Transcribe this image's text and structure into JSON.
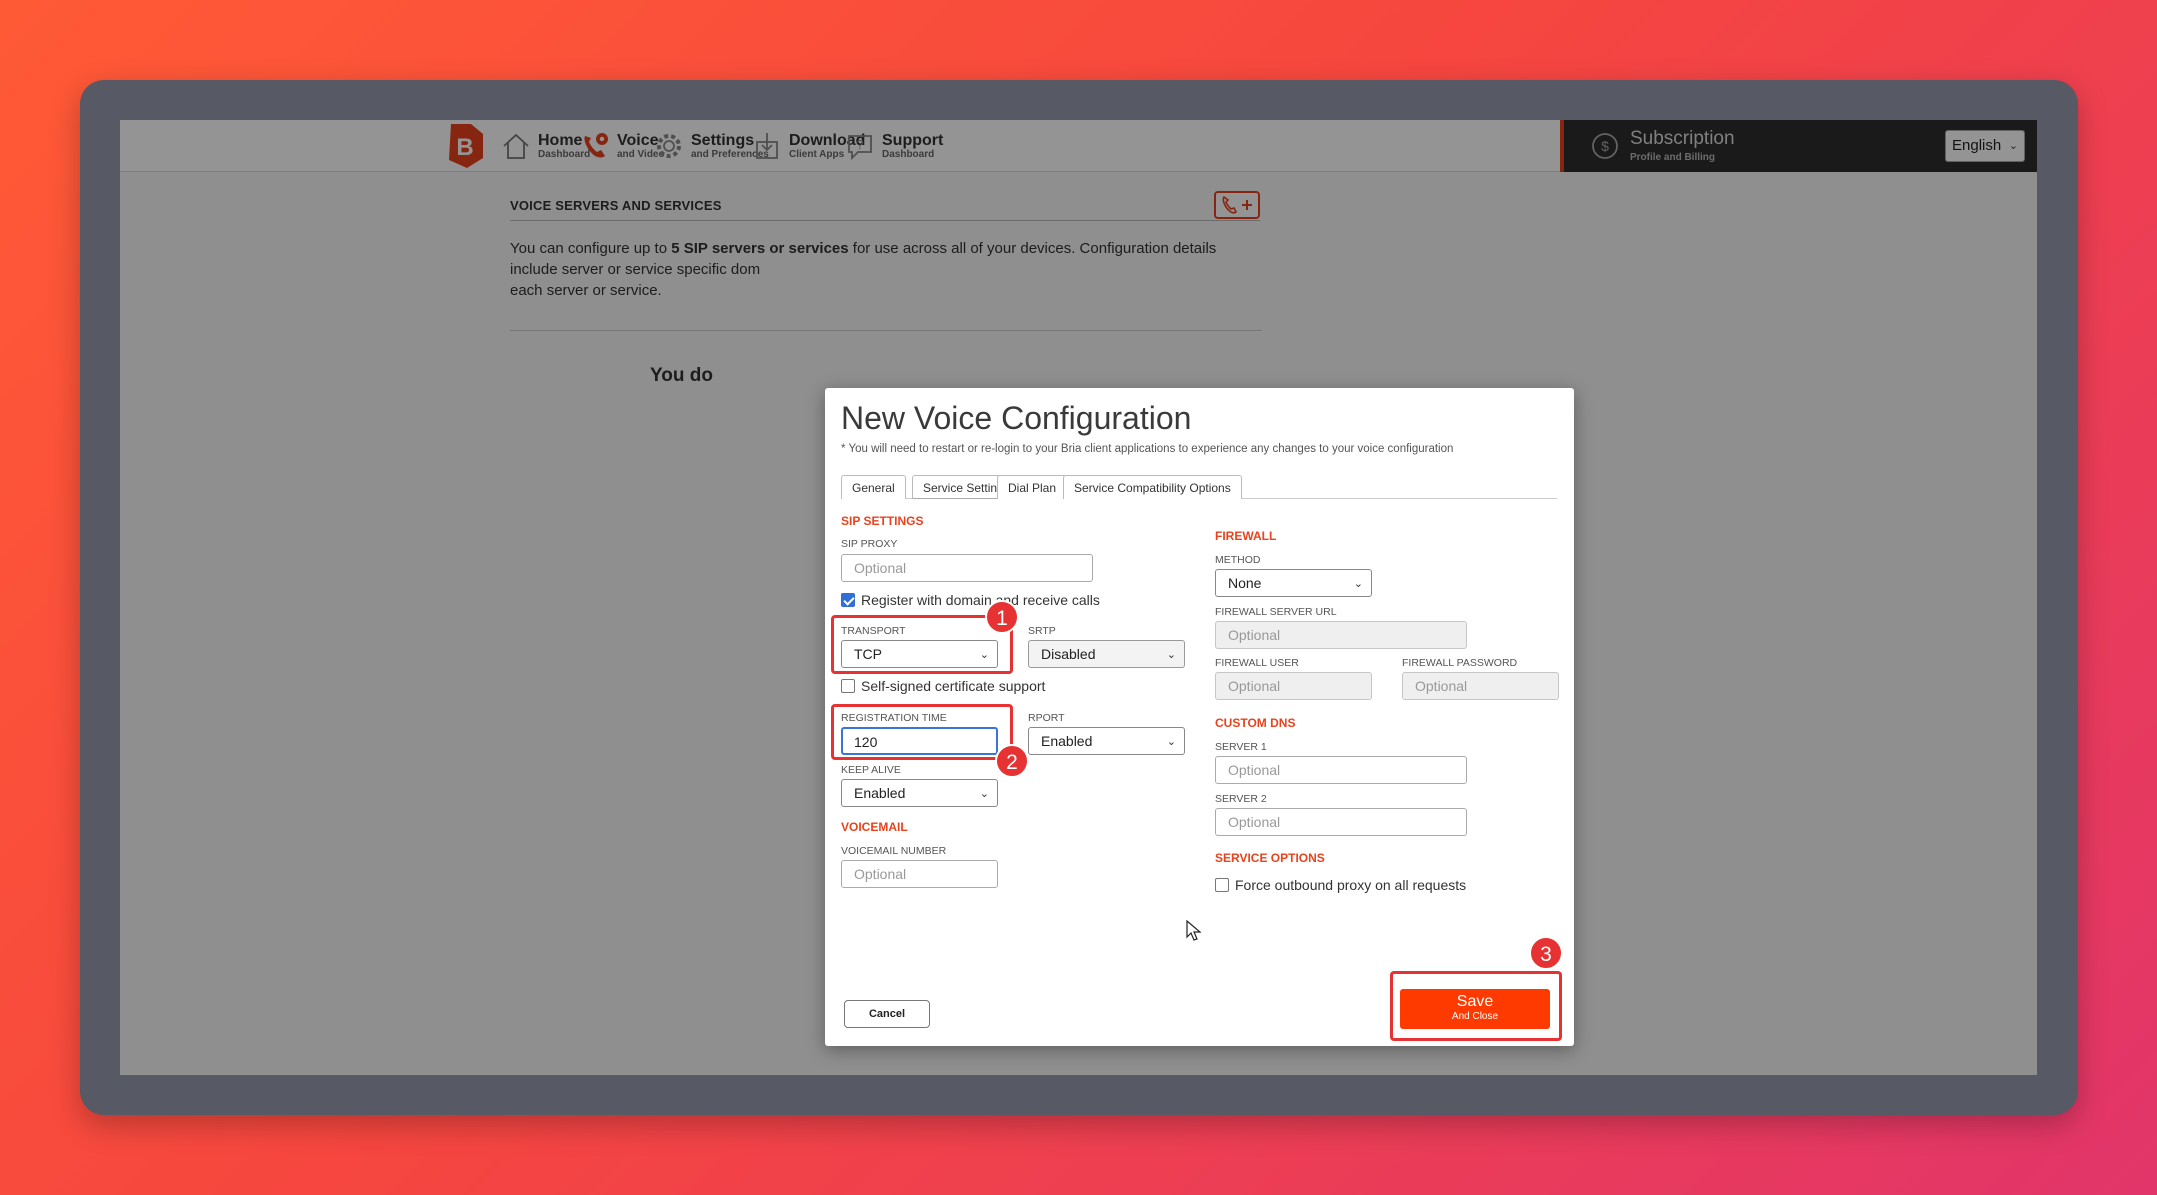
{
  "nav": {
    "items": [
      {
        "title": "Home",
        "subtitle": "Dashboard",
        "icon": "home-icon"
      },
      {
        "title": "Voice",
        "subtitle": "and Video",
        "icon": "phone-gear-icon"
      },
      {
        "title": "Settings",
        "subtitle": "and Preferences",
        "icon": "gear-icon"
      },
      {
        "title": "Download",
        "subtitle": "Client Apps",
        "icon": "download-icon"
      },
      {
        "title": "Support",
        "subtitle": "Dashboard",
        "icon": "support-chat-icon"
      }
    ],
    "subscription": {
      "title": "Subscription",
      "subtitle": "Profile and Billing",
      "icon": "dollar-refresh-icon"
    },
    "language": "English"
  },
  "page": {
    "heading": "VOICE SERVERS AND SERVICES",
    "paragraph_pre": "You can configure up to ",
    "paragraph_bold": "5 SIP servers or services",
    "paragraph_post": " for use across all of your devices. Configuration details include server or service specific dom",
    "paragraph_line3": "each server or service.",
    "partial_text": "You do"
  },
  "modal": {
    "title": "New Voice Configuration",
    "note": "* You will need to restart or re-login to your Bria client applications to experience any changes to your voice configuration",
    "tabs": [
      "General",
      "Service Settings",
      "Dial Plan",
      "Service Compatibility Options"
    ],
    "active_tab": "Service Settings",
    "sip": {
      "section": "SIP SETTINGS",
      "proxy_label": "SIP PROXY",
      "proxy_placeholder": "Optional",
      "register_label": "Register with domain and receive calls",
      "register_checked": true,
      "transport_label": "TRANSPORT",
      "transport_value": "TCP",
      "srtp_label": "SRTP",
      "srtp_value": "Disabled",
      "selfsigned_label": "Self-signed certificate support",
      "selfsigned_checked": false,
      "regtime_label": "REGISTRATION TIME",
      "regtime_value": "120",
      "rport_label": "RPORT",
      "rport_value": "Enabled",
      "keepalive_label": "KEEP ALIVE",
      "keepalive_value": "Enabled"
    },
    "voicemail": {
      "section": "VOICEMAIL",
      "number_label": "VOICEMAIL NUMBER",
      "number_placeholder": "Optional"
    },
    "firewall": {
      "section": "FIREWALL",
      "method_label": "METHOD",
      "method_value": "None",
      "server_url_label": "FIREWALL SERVER URL",
      "server_url_placeholder": "Optional",
      "user_label": "FIREWALL USER",
      "user_placeholder": "Optional",
      "password_label": "FIREWALL PASSWORD",
      "password_placeholder": "Optional"
    },
    "dns": {
      "section": "CUSTOM DNS",
      "server1_label": "SERVER 1",
      "server1_placeholder": "Optional",
      "server2_label": "SERVER 2",
      "server2_placeholder": "Optional"
    },
    "service_options": {
      "section": "SERVICE OPTIONS",
      "force_proxy_label": "Force outbound proxy on all requests",
      "force_proxy_checked": false
    },
    "cancel_label": "Cancel",
    "save_label": "Save",
    "save_sublabel": "And Close"
  },
  "annotations": [
    "1",
    "2",
    "3"
  ],
  "colors": {
    "accent": "#e8431d",
    "highlight": "#e63232",
    "save": "#ff3a00"
  }
}
